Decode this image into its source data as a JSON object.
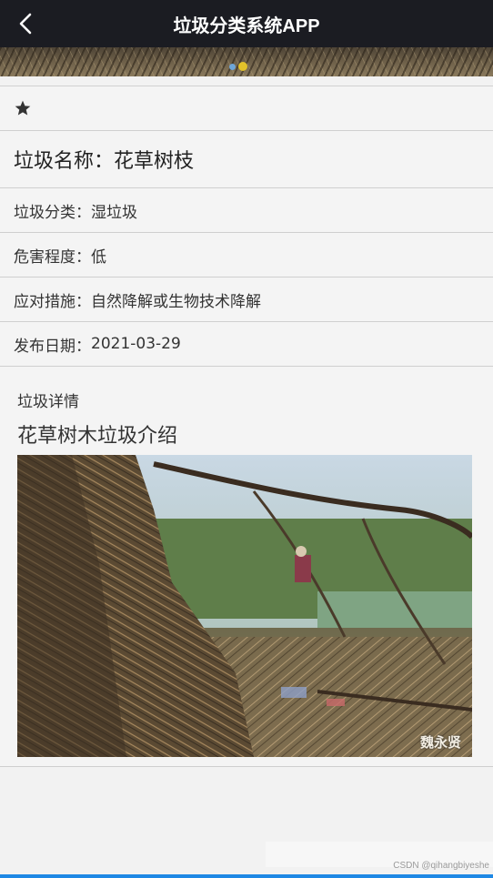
{
  "header": {
    "title": "垃圾分类系统APP",
    "back_icon": "chevron-left-icon"
  },
  "favorite": {
    "icon": "star-icon"
  },
  "item": {
    "name_label": "垃圾名称：",
    "name": "花草树枝",
    "category_label": "垃圾分类：",
    "category": "湿垃圾",
    "hazard_label": "危害程度：",
    "hazard": "低",
    "measure_label": "应对措施：",
    "measure": "自然降解或生物技术降解",
    "date_label": "发布日期：",
    "date": "2021-03-29"
  },
  "details": {
    "label": "垃圾详情",
    "heading": "花草树木垃圾介绍",
    "photo_watermark": "魏永贤"
  },
  "footer": {
    "credit": "CSDN @qihangbiyeshe"
  },
  "colors": {
    "header_bg": "#1b1c22",
    "accent_bar": "#1e88e5"
  }
}
